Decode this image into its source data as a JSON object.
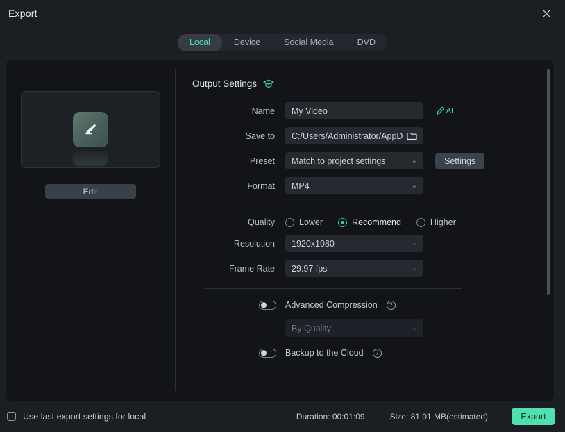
{
  "window": {
    "title": "Export",
    "close_icon": "close-icon"
  },
  "tabs": [
    {
      "label": "Local",
      "active": true
    },
    {
      "label": "Device",
      "active": false
    },
    {
      "label": "Social Media",
      "active": false
    },
    {
      "label": "DVD",
      "active": false
    }
  ],
  "preview": {
    "thumbnail_icon": "edit-pencil-icon",
    "edit_label": "Edit"
  },
  "output_settings": {
    "heading": "Output Settings",
    "heading_icon": "graduation-cap-icon",
    "name": {
      "label": "Name",
      "value": "My Video",
      "ai_label": "AI",
      "ai_icon": "ai-pencil-icon"
    },
    "save_to": {
      "label": "Save to",
      "value": "C:/Users/Administrator/AppD",
      "browse_icon": "folder-icon"
    },
    "preset": {
      "label": "Preset",
      "value": "Match to project settings",
      "settings_button": "Settings"
    },
    "format": {
      "label": "Format",
      "value": "MP4"
    }
  },
  "quality_section": {
    "quality": {
      "label": "Quality",
      "options": [
        {
          "label": "Lower",
          "selected": false
        },
        {
          "label": "Recommend",
          "selected": true
        },
        {
          "label": "Higher",
          "selected": false
        }
      ]
    },
    "resolution": {
      "label": "Resolution",
      "value": "1920x1080"
    },
    "frame_rate": {
      "label": "Frame Rate",
      "value": "29.97 fps"
    }
  },
  "advanced_section": {
    "advanced_compression": {
      "label": "Advanced Compression",
      "enabled": false,
      "help_icon": "question-mark-icon",
      "help_glyph": "?"
    },
    "compression_mode": {
      "value": "By Quality",
      "disabled": true
    },
    "backup_cloud": {
      "label": "Backup to the Cloud",
      "enabled": false,
      "help_icon": "question-mark-icon",
      "help_glyph": "?"
    }
  },
  "footer": {
    "use_last_settings": {
      "label": "Use last export settings for local",
      "checked": false
    },
    "duration": "Duration: 00:01:09",
    "size": "Size: 81.01 MB(estimated)",
    "export_label": "Export"
  },
  "colors": {
    "accent": "#4fe0b6",
    "export_button": "#4fe0b0",
    "panel_bg": "#121417",
    "window_bg": "#1b1f24"
  }
}
